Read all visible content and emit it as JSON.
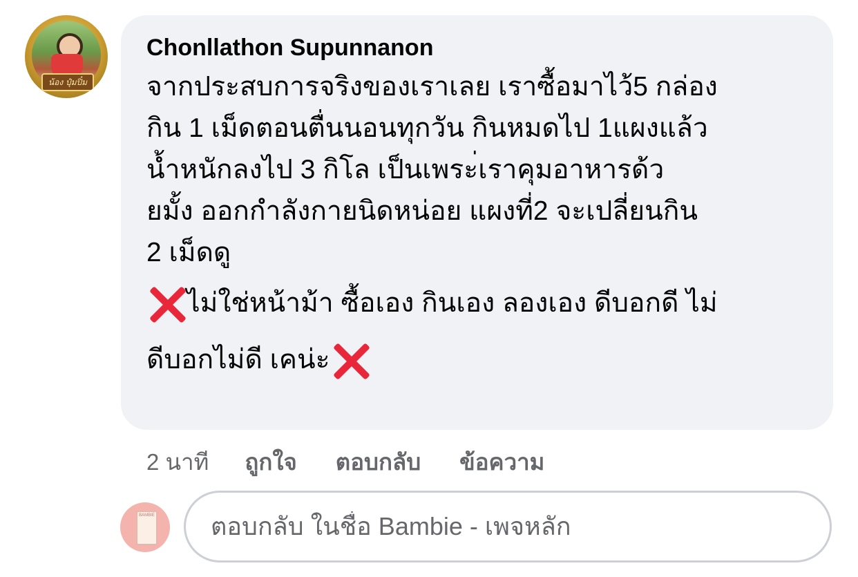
{
  "comment": {
    "author": "Chonllathon Supunnanon",
    "avatar_tag": "น้อง ปุ๋มปิ๋ม",
    "lines": [
      "จากประสบการจริงของเราเลย เราซื้อมาไว้5 กล่อง",
      "กิน 1 เม็ดตอนตื่นนอนทุกวัน  กินหมดไป 1แผงแล้ว",
      "น้ำหนักลงไป 3 กิโล  เป็นเพระ่เราคุมอาหารด้ว",
      "ยมั้ง ออกกำลังกายนิดหน่อย แผงที่2 จะเปลี่ยนกิน",
      "2 เม็ดดู"
    ],
    "emoji_line_1": "ไม่ใช่หน้าม้า ซื้อเอง กินเอง ลองเอง ดีบอกดี ไม่",
    "emoji_line_2": "ดีบอกไม่ดี เคน่ะ",
    "emoji_icon": "cross-mark-icon"
  },
  "actions": {
    "time": "2 นาที",
    "like": "ถูกใจ",
    "reply": "ตอบกลับ",
    "message": "ข้อความ"
  },
  "reply": {
    "placeholder": "ตอบกลับ ในชื่อ Bambie - เพจหลัก"
  },
  "colors": {
    "bubble": "#f0f2f5",
    "secondary_text": "#65676b",
    "cross": "#e8283a",
    "reply_border": "#ccd0d5"
  }
}
